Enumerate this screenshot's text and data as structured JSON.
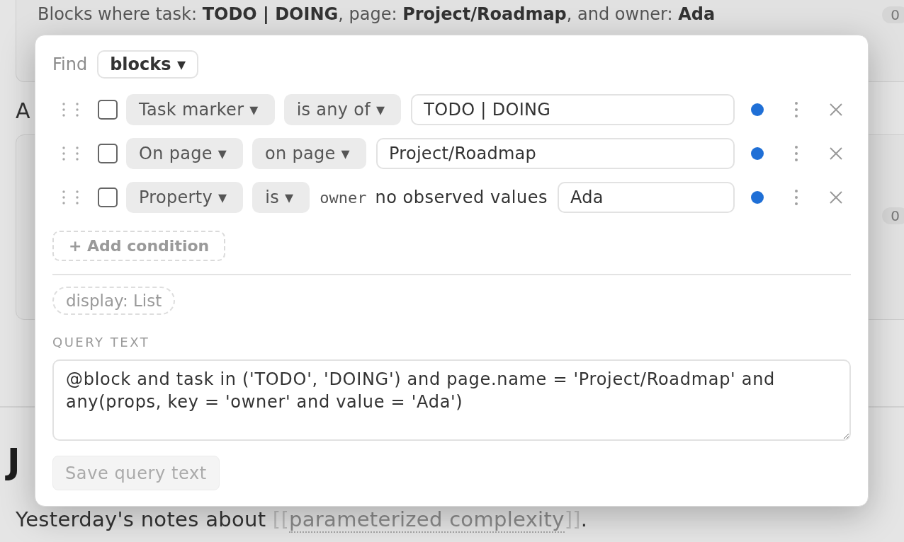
{
  "background_page": {
    "summary_card": {
      "summary": "Blocks where task: **TODO | DOING**, page: **Project/Roadmap**, and owner: **Ada**",
      "count": "0"
    },
    "section_heading": "A",
    "results_card": {
      "count": "0"
    },
    "page_heading": "J",
    "paragraph": {
      "before": "Yesterday's notes about ",
      "link": {
        "open": "[[",
        "label": "parameterized complexity",
        "close": "]]"
      },
      "after": "."
    }
  },
  "query_editor": {
    "find_label": "Find",
    "find_target": "blocks ▾",
    "conditions": [
      {
        "kind": "basic",
        "checked": false,
        "field": "Task marker ▾",
        "operator": "is any of ▾",
        "value": "TODO | DOING",
        "active": true
      },
      {
        "kind": "basic",
        "checked": false,
        "field": "On page ▾",
        "operator": "on page ▾",
        "value": "Project/Roadmap",
        "active": true
      },
      {
        "kind": "property",
        "checked": false,
        "field": "Property ▾",
        "operator": "is ▾",
        "property_key": "owner",
        "hint": "no observed values",
        "value": "Ada",
        "active": true
      }
    ],
    "add_condition": "+ Add condition",
    "display": "display: List",
    "query_text_label": "QUERY TEXT",
    "query_text": "@block and task in ('TODO', 'DOING') and page.name = 'Project/Roadmap' and any(props, key = 'owner' and value = 'Ada')",
    "save_button": {
      "label": "Save query text",
      "disabled": true
    }
  }
}
